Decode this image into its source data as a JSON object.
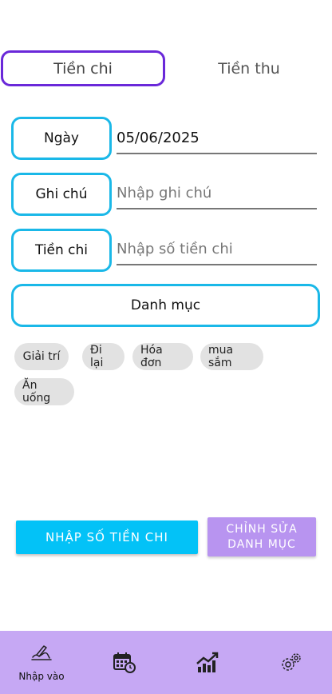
{
  "tabs": {
    "expense": "Tiền chi",
    "income": "Tiền thu"
  },
  "form": {
    "date_label": "Ngày",
    "date_value": "05/06/2025",
    "note_label": "Ghi chú",
    "note_placeholder": "Nhập ghi chú",
    "amount_label": "Tiền chi",
    "amount_placeholder": "Nhập số tiền chi",
    "category_label": "Danh mục"
  },
  "categories": [
    "Giải trí",
    "Đi lại",
    "Hóa đơn",
    "mua sắm",
    "Ăn uống"
  ],
  "actions": {
    "submit": "NHẬP SỐ TIỀN CHI",
    "edit_line1": "CHỈNH SỬA",
    "edit_line2": "DANH MỤC"
  },
  "bottom_nav": {
    "items": [
      {
        "icon": "pen-hand-icon",
        "label": "Nhập vào"
      },
      {
        "icon": "calendar-clock-icon",
        "label": ""
      },
      {
        "icon": "chart-trend-icon",
        "label": ""
      },
      {
        "icon": "gear-icon",
        "label": ""
      }
    ]
  },
  "colors": {
    "accent": "#6a28d9",
    "field_border": "#1ab8e8",
    "primary_button": "#03c2f7",
    "secondary_button": "#b894f0",
    "nav_background": "#c6a8f4",
    "chip": "#e2e2e2"
  }
}
